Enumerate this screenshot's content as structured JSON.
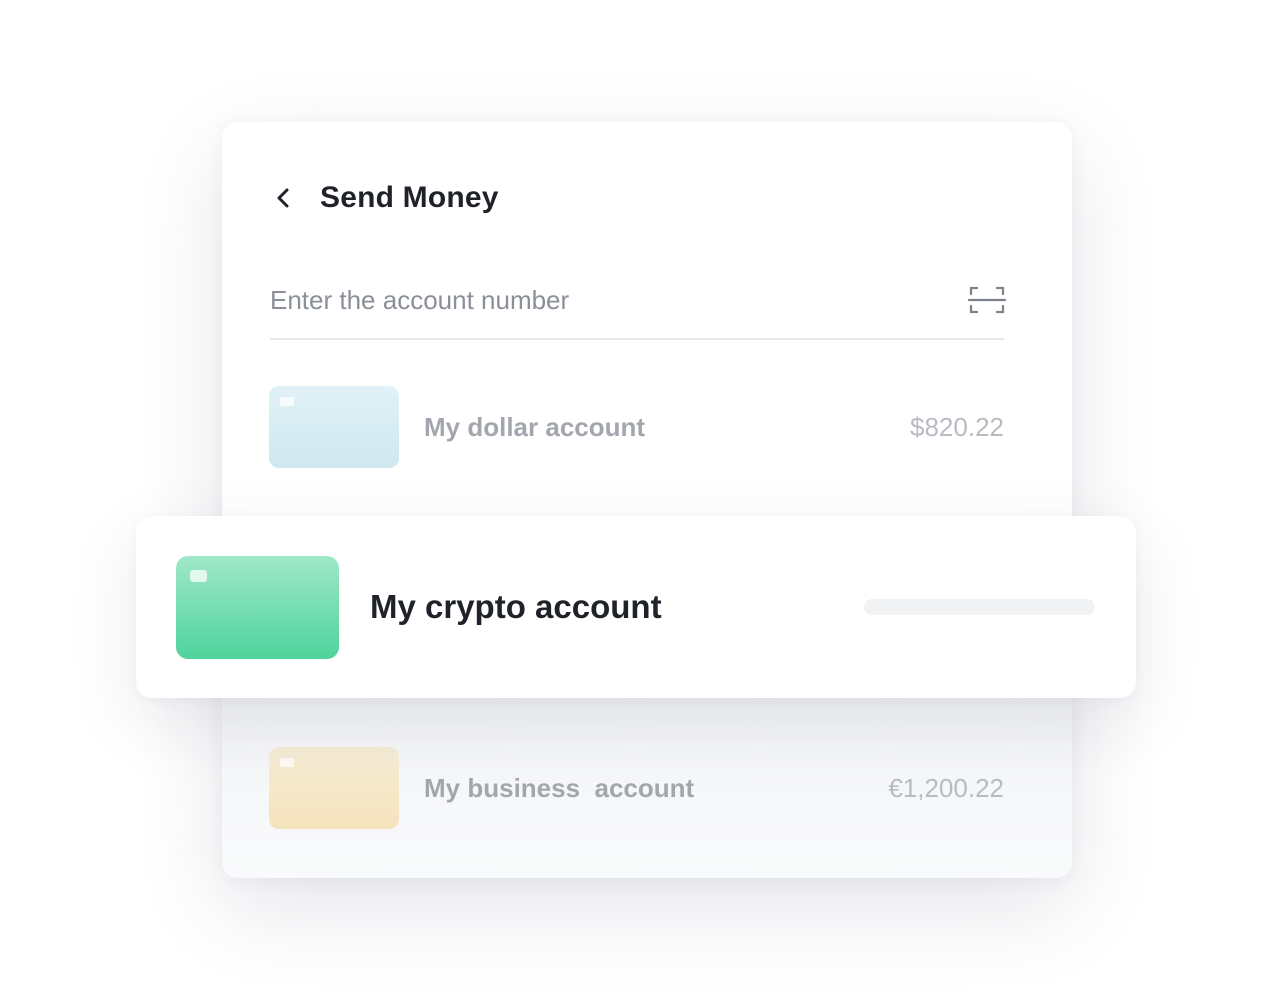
{
  "header": {
    "title": "Send Money",
    "back_icon": "chevron-left-icon"
  },
  "account_input": {
    "placeholder": "Enter the account number",
    "value": "",
    "scan_icon": "scan-qr-icon"
  },
  "accounts": [
    {
      "name": "My dollar account",
      "balance": "$820.22",
      "card_color": "#d4ebf1"
    },
    {
      "name": "My crypto account",
      "balance": "",
      "card_color": "#5fd8a6",
      "selected": true
    },
    {
      "name": "My business  account",
      "balance": "€1,200.22",
      "card_color": "#f6e6c4"
    }
  ],
  "colors": {
    "title_text": "#1f2329",
    "muted_text": "#a3a7ad",
    "accent_green": "#4fd39c"
  }
}
